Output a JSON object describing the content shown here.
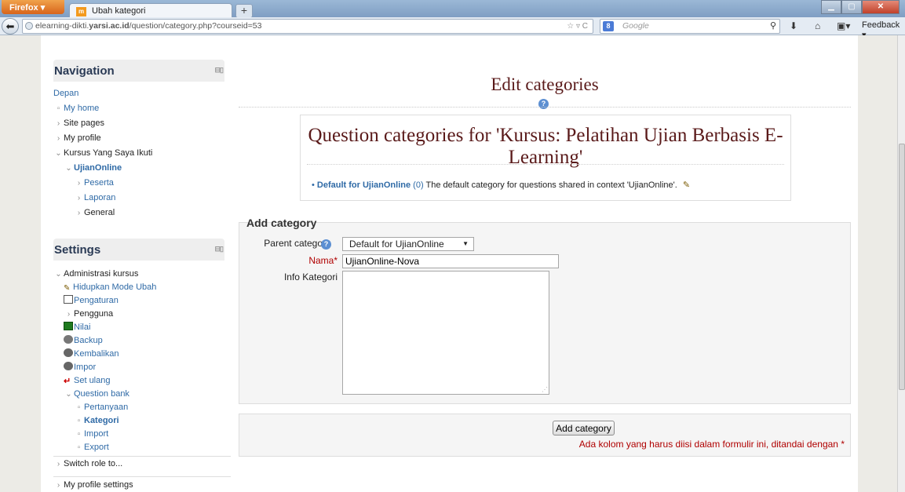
{
  "browser": {
    "app_menu": "Firefox",
    "tab_title": "Ubah kategori",
    "tab_favicon_text": "m",
    "new_tab": "+",
    "url_prefix": "elearning-dikti.",
    "url_domain": "yarsi.ac.id",
    "url_path": "/question/category.php?courseid=53",
    "search_placeholder": "Google",
    "search_engine_letter": "8",
    "feedback": "Feedback"
  },
  "navigation": {
    "title": "Navigation",
    "items": [
      {
        "label": "Depan",
        "bullet": ""
      },
      {
        "label": "My home",
        "bullet": "▫"
      },
      {
        "label": "Site pages",
        "bullet": "›"
      },
      {
        "label": "My profile",
        "bullet": "›"
      },
      {
        "label": "Kursus Yang Saya Ikuti",
        "bullet": "⌄"
      },
      {
        "label": "UjianOnline",
        "bullet": "⌄"
      },
      {
        "label": "Peserta",
        "bullet": "›"
      },
      {
        "label": "Laporan",
        "bullet": "›"
      },
      {
        "label": "General",
        "bullet": "›"
      }
    ]
  },
  "settings": {
    "title": "Settings",
    "items": [
      {
        "label": "Administrasi kursus",
        "bullet": "⌄"
      },
      {
        "label": "Hidupkan Mode Ubah"
      },
      {
        "label": "Pengaturan"
      },
      {
        "label": "Pengguna",
        "bullet": "›"
      },
      {
        "label": "Nilai"
      },
      {
        "label": "Backup"
      },
      {
        "label": "Kembalikan"
      },
      {
        "label": "Impor"
      },
      {
        "label": "Set ulang"
      },
      {
        "label": "Question bank",
        "bullet": "⌄"
      },
      {
        "label": "Pertanyaan",
        "bullet": "▫"
      },
      {
        "label": "Kategori",
        "bullet": "▫"
      },
      {
        "label": "Import",
        "bullet": "▫"
      },
      {
        "label": "Export",
        "bullet": "▫"
      },
      {
        "label": "Switch role to...",
        "bullet": "›"
      },
      {
        "label": "My profile settings",
        "bullet": "›"
      }
    ]
  },
  "main": {
    "heading": "Edit categories",
    "help_glyph": "?",
    "qcat_title": "Question categories for 'Kursus: Pelatihan Ujian Berbasis E-Learning'",
    "qcat_link": "Default for UjianOnline",
    "qcat_count": "(0)",
    "qcat_desc": "The default category for questions shared in context 'UjianOnline'.",
    "form": {
      "legend": "Add category",
      "parent_label": "Parent category",
      "parent_value": "Default for UjianOnline",
      "name_label": "Nama",
      "name_value": "UjianOnline-Nova",
      "info_label": "Info Kategori",
      "info_value": "",
      "required_star": "*",
      "submit": "Add category",
      "required_note": "Ada kolom yang harus diisi dalam formulir ini, ditandai dengan"
    }
  },
  "colors": {
    "link": "#2f6aa6",
    "heading": "#5a1a1a",
    "required": "#b00000"
  }
}
